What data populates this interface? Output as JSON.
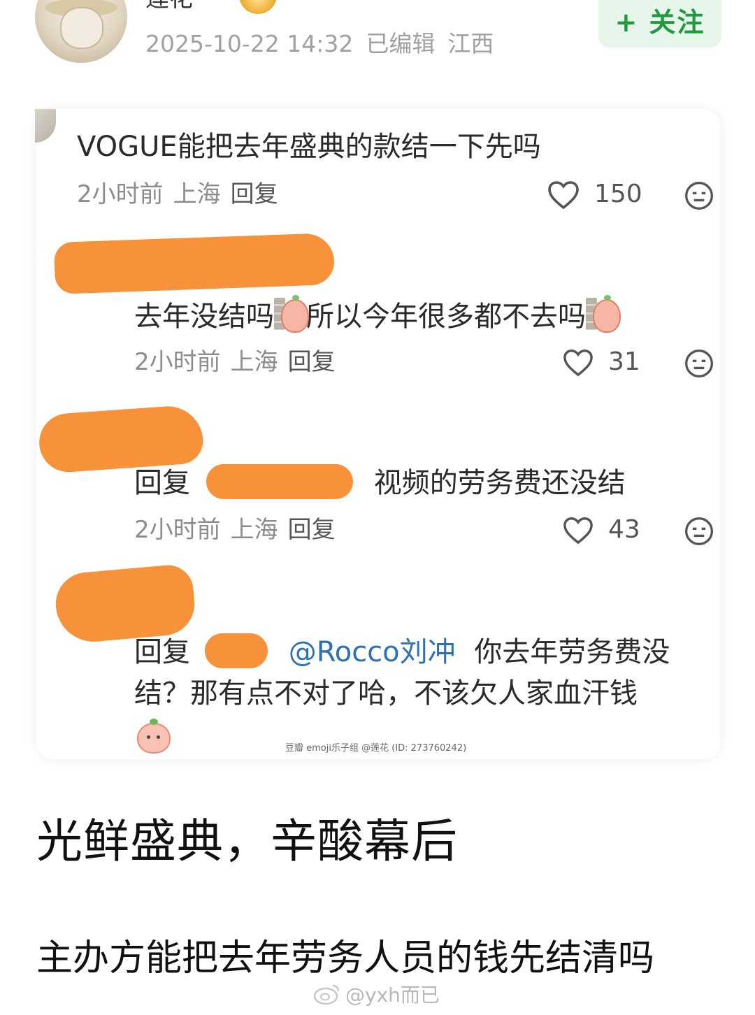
{
  "post": {
    "username": "莲花",
    "timestamp": "2025-10-22 14:32",
    "edited": "已编辑",
    "location": "江西",
    "follow_label": "+ 关注"
  },
  "comments": [
    {
      "text": "VOGUE能把去年盛典的款结一下先吗",
      "time": "2小时前",
      "location": "上海",
      "reply_label": "回复",
      "likes": "150"
    },
    {
      "text_part1": "去年没结吗",
      "text_part2": "所以今年很多都不去吗",
      "time": "2小时前",
      "location": "上海",
      "reply_label": "回复",
      "likes": "31"
    },
    {
      "reply_prefix": "回复",
      "text": "视频的劳务费还没结",
      "time": "2小时前",
      "location": "上海",
      "reply_label": "回复",
      "likes": "43"
    },
    {
      "reply_prefix": "回复",
      "mention": "@Rocco刘冲",
      "text_line1": "你去年劳务费没",
      "text_line2": "结？那有点不对了哈，不该欠人家血汗钱"
    }
  ],
  "watermark": "豆瓣 emoji乐子组 @莲花 (ID: 273760242)",
  "headline": "光鲜盛典，辛酸幕后",
  "body": "主办方能把去年劳务人员的钱先结清吗",
  "weibo_mark": "@yxh而已",
  "colors": {
    "follow_green": "#1f9a3c",
    "redaction_orange": "#f7923b",
    "mention_blue": "#2f6fb5"
  }
}
